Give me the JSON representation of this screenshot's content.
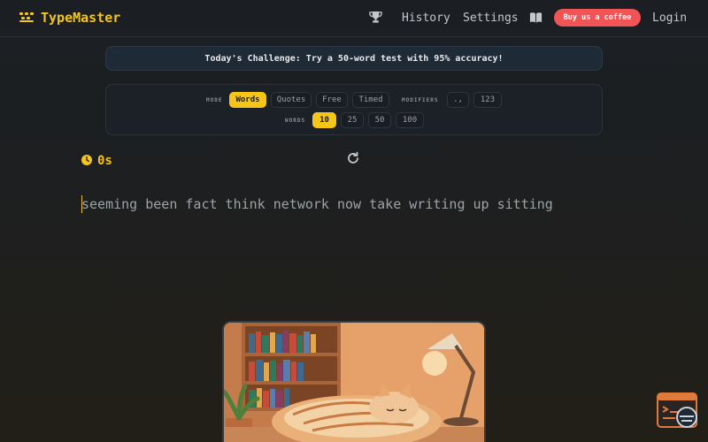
{
  "header": {
    "brand": "TypeMaster",
    "nav": {
      "history": "History",
      "settings": "Settings",
      "login": "Login"
    },
    "coffee_button": "Buy us a coffee",
    "icons": {
      "trophy": "trophy-icon",
      "book": "book-icon",
      "logo": "keyboard-icon"
    }
  },
  "challenge": {
    "text": "Today's Challenge: Try a 50-word test with 95% accuracy!"
  },
  "options": {
    "mode_label": "MODE",
    "modes": [
      {
        "label": "Words",
        "active": true
      },
      {
        "label": "Quotes",
        "active": false
      },
      {
        "label": "Free",
        "active": false
      },
      {
        "label": "Timed",
        "active": false
      }
    ],
    "modifiers_label": "MODIFIERS",
    "modifiers": [
      {
        "label": ".,",
        "active": false
      },
      {
        "label": "123",
        "active": false
      }
    ],
    "words_label": "WORDS",
    "word_counts": [
      {
        "label": "10",
        "active": true
      },
      {
        "label": "25",
        "active": false
      },
      {
        "label": "50",
        "active": false
      },
      {
        "label": "100",
        "active": false
      }
    ]
  },
  "timer": {
    "value": "0s"
  },
  "typing": {
    "text": "seeming been fact think network now take writing up sitting"
  },
  "colors": {
    "accent": "#f5c518",
    "coffee": "#f05454",
    "background": "#1d1f20"
  }
}
